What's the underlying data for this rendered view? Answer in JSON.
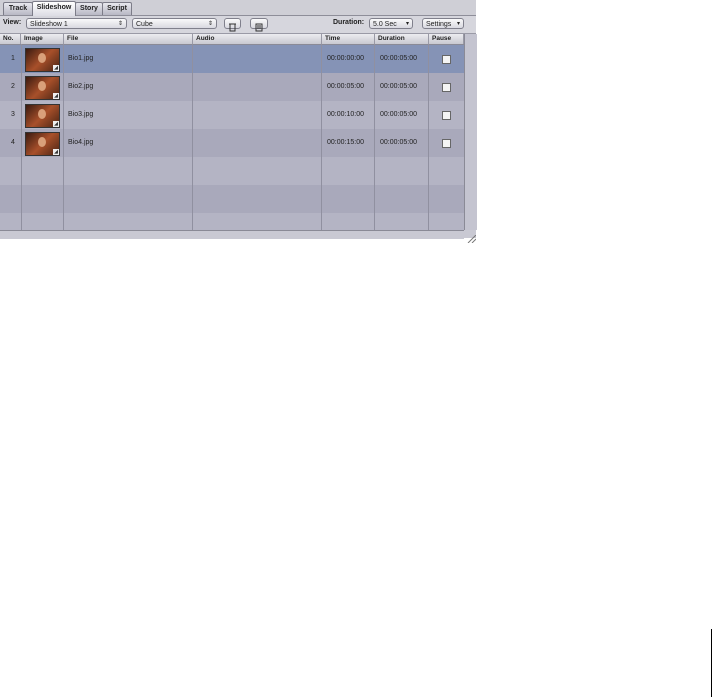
{
  "tabs": [
    "Track",
    "Slideshow",
    "Story",
    "Script"
  ],
  "toolbar": {
    "view_label": "View:",
    "view_value": "Slideshow 1",
    "transition_value": "Cube",
    "duration_label": "Duration:",
    "duration_value": "5.0 Sec",
    "settings_label": "Settings"
  },
  "columns": [
    "No.",
    "Image",
    "File",
    "Audio",
    "Time",
    "Duration",
    "Pause"
  ],
  "rows": [
    {
      "no": "1",
      "file": "Bio1.jpg",
      "audio": "",
      "time": "00:00:00:00",
      "duration": "00:00:05:00"
    },
    {
      "no": "2",
      "file": "Bio2.jpg",
      "audio": "",
      "time": "00:00:05:00",
      "duration": "00:00:05:00"
    },
    {
      "no": "3",
      "file": "Bio3.jpg",
      "audio": "",
      "time": "00:00:10:00",
      "duration": "00:00:05:00"
    },
    {
      "no": "4",
      "file": "Bio4.jpg",
      "audio": "",
      "time": "00:00:15:00",
      "duration": "00:00:05:00"
    }
  ]
}
